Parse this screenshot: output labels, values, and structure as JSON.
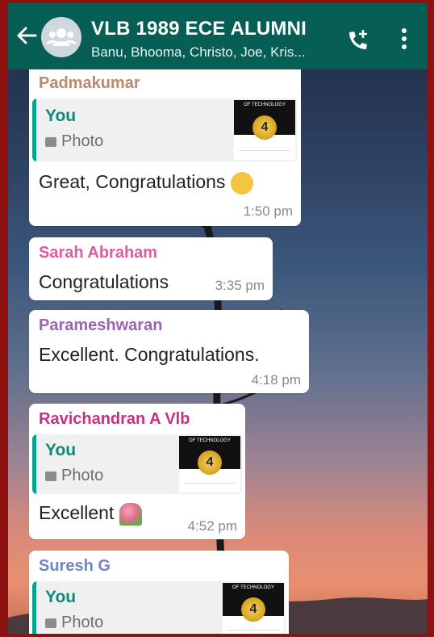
{
  "header": {
    "title": "VLB 1989 ECE ALUMNI",
    "subtitle": "Banu, Bhooma, Christo, Joe, Kris..."
  },
  "colors": {
    "appbar": "#075e54",
    "quote_accent": "#06a38f",
    "you_name": "#0a8b7b"
  },
  "icons": [
    "back-arrow-icon",
    "group-avatar-icon",
    "add-call-icon",
    "more-vertical-icon",
    "photo-icon",
    "clapping-hands-emoji",
    "bouquet-emoji"
  ],
  "messages": [
    {
      "sender": "Padmakumar",
      "sender_color": "#b88a6f",
      "quote": {
        "name": "You",
        "type": "Photo",
        "thumb_rank": "4",
        "thumb_text": "OF TECHNOLOGY"
      },
      "text": "Great, Congratulations",
      "time": "1:50 pm"
    },
    {
      "sender": "Sarah Abraham",
      "sender_color": "#e05aa0",
      "text": "Congratulations",
      "time": "3:35 pm"
    },
    {
      "sender": "Parameshwaran",
      "sender_color": "#9b63b5",
      "text": "Excellent.  Congratulations.",
      "time": "4:18 pm"
    },
    {
      "sender": "Ravichandran A Vlb",
      "sender_color": "#c7317f",
      "quote": {
        "name": "You",
        "type": "Photo",
        "thumb_rank": "4",
        "thumb_text": "OF TECHNOLOGY"
      },
      "text": "Excellent",
      "time": "4:52 pm"
    },
    {
      "sender": "Suresh G",
      "sender_color": "#6f85c4",
      "quote": {
        "name": "You",
        "type": "Photo",
        "thumb_rank": "4",
        "thumb_text": "OF TECHNOLOGY"
      }
    }
  ]
}
